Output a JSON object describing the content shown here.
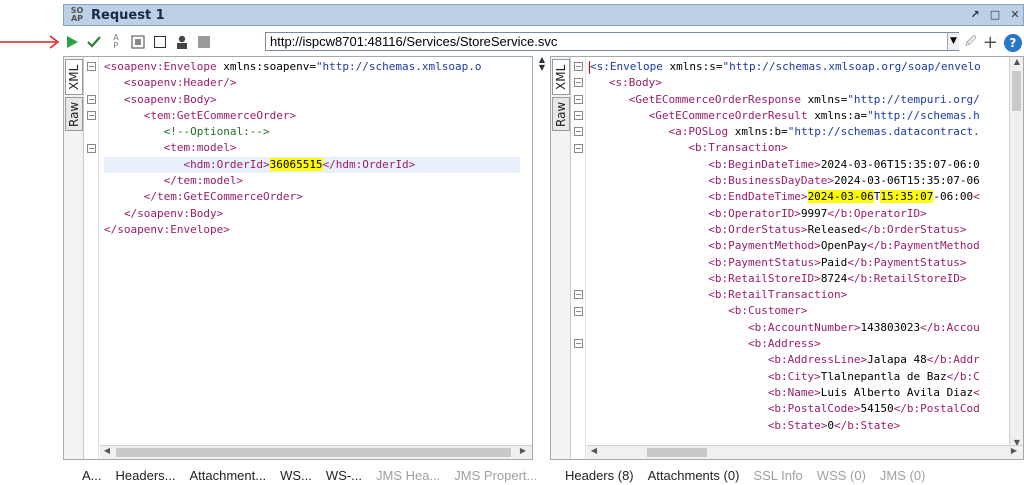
{
  "window": {
    "logo": "SO\nAP",
    "title": "Request 1",
    "buttons": [
      "restore-icon",
      "maximize-icon",
      "close-icon"
    ]
  },
  "toolbar": {
    "icons": [
      "play-icon",
      "add-wss-icon",
      "ws-a-icon",
      "format-icon",
      "checkbox-icon",
      "user-icon",
      "stop-icon"
    ],
    "url": "http://ispcw8701:48116/Services/StoreService.svc",
    "add_label": "+",
    "help_label": "?"
  },
  "request": {
    "tabs": [
      "XML",
      "Raw"
    ],
    "lines": [
      [
        {
          "c": "tag",
          "t": "<soapenv:Envelope "
        },
        {
          "c": "attr",
          "t": "xmlns:soapenv"
        },
        {
          "c": "txt",
          "t": "="
        },
        {
          "c": "str",
          "t": "\"http://schemas.xmlsoap.o"
        }
      ],
      [
        {
          "c": "txt",
          "t": "   "
        },
        {
          "c": "tag",
          "t": "<soapenv:Header/>"
        }
      ],
      [
        {
          "c": "txt",
          "t": "   "
        },
        {
          "c": "tag",
          "t": "<soapenv:Body>"
        }
      ],
      [
        {
          "c": "txt",
          "t": "      "
        },
        {
          "c": "tag",
          "t": "<tem:GetECommerceOrder>"
        }
      ],
      [
        {
          "c": "txt",
          "t": "         "
        },
        {
          "c": "cmt",
          "t": "<!--Optional:-->"
        }
      ],
      [
        {
          "c": "txt",
          "t": "         "
        },
        {
          "c": "tag",
          "t": "<tem:model>"
        }
      ],
      [
        {
          "c": "txt",
          "t": "            "
        },
        {
          "c": "tag",
          "t": "<hdm:OrderId>"
        },
        {
          "c": "hl",
          "t": "36065515"
        },
        {
          "c": "tag",
          "t": "</hdm:OrderId>"
        }
      ],
      [
        {
          "c": "txt",
          "t": "         "
        },
        {
          "c": "tag",
          "t": "</tem:model>"
        }
      ],
      [
        {
          "c": "txt",
          "t": "      "
        },
        {
          "c": "tag",
          "t": "</tem:GetECommerceOrder>"
        }
      ],
      [
        {
          "c": "txt",
          "t": "   "
        },
        {
          "c": "tag",
          "t": "</soapenv:Body>"
        }
      ],
      [
        {
          "c": "tag",
          "t": "</soapenv:Envelope>"
        }
      ]
    ],
    "bottom_tabs": [
      {
        "label": "A...",
        "enabled": true
      },
      {
        "label": "Headers...",
        "enabled": true
      },
      {
        "label": "Attachment...",
        "enabled": true
      },
      {
        "label": "WS...",
        "enabled": true
      },
      {
        "label": "WS-...",
        "enabled": true
      },
      {
        "label": "JMS Hea...",
        "enabled": false
      },
      {
        "label": "JMS Propert...",
        "enabled": false
      }
    ]
  },
  "response": {
    "tabs": [
      "XML",
      "Raw"
    ],
    "lines": [
      [
        {
          "c": "tagb",
          "t": "<s:Envelope "
        },
        {
          "c": "attr",
          "t": "xmlns:s"
        },
        {
          "c": "txt",
          "t": "="
        },
        {
          "c": "str",
          "t": "\"http://schemas.xmlsoap.org/soap/envelo"
        }
      ],
      [
        {
          "c": "txt",
          "t": "   "
        },
        {
          "c": "tag",
          "t": "<s:Body>"
        }
      ],
      [
        {
          "c": "txt",
          "t": "      "
        },
        {
          "c": "tag",
          "t": "<GetECommerceOrderResponse "
        },
        {
          "c": "attr",
          "t": "xmlns"
        },
        {
          "c": "txt",
          "t": "="
        },
        {
          "c": "str",
          "t": "\"http://tempuri.org/"
        }
      ],
      [
        {
          "c": "txt",
          "t": "         "
        },
        {
          "c": "tag",
          "t": "<GetECommerceOrderResult "
        },
        {
          "c": "attr",
          "t": "xmlns:a"
        },
        {
          "c": "txt",
          "t": "="
        },
        {
          "c": "str",
          "t": "\"http://schemas.h"
        }
      ],
      [
        {
          "c": "txt",
          "t": "            "
        },
        {
          "c": "tag",
          "t": "<a:POSLog "
        },
        {
          "c": "attr",
          "t": "xmlns:b"
        },
        {
          "c": "txt",
          "t": "="
        },
        {
          "c": "str",
          "t": "\"http://schemas.datacontract."
        }
      ],
      [
        {
          "c": "txt",
          "t": "               "
        },
        {
          "c": "tag",
          "t": "<b:Transaction>"
        }
      ],
      [
        {
          "c": "txt",
          "t": "                  "
        },
        {
          "c": "tag",
          "t": "<b:BeginDateTime>"
        },
        {
          "c": "txt",
          "t": "2024-03-06T15:35:07-06:0"
        }
      ],
      [
        {
          "c": "txt",
          "t": "                  "
        },
        {
          "c": "tag",
          "t": "<b:BusinessDayDate>"
        },
        {
          "c": "txt",
          "t": "2024-03-06T15:35:07-06"
        }
      ],
      [
        {
          "c": "txt",
          "t": "                  "
        },
        {
          "c": "tag",
          "t": "<b:EndDateTime>"
        },
        {
          "c": "hl",
          "t": "2024-03-06"
        },
        {
          "c": "txt",
          "t": "T"
        },
        {
          "c": "hl",
          "t": "15:35:07"
        },
        {
          "c": "txt",
          "t": "-06:00"
        },
        {
          "c": "tag",
          "t": "<"
        }
      ],
      [
        {
          "c": "txt",
          "t": "                  "
        },
        {
          "c": "tag",
          "t": "<b:OperatorID>"
        },
        {
          "c": "txt",
          "t": "9997"
        },
        {
          "c": "tag",
          "t": "</b:OperatorID>"
        }
      ],
      [
        {
          "c": "txt",
          "t": "                  "
        },
        {
          "c": "tag",
          "t": "<b:OrderStatus>"
        },
        {
          "c": "txt",
          "t": "Released"
        },
        {
          "c": "tag",
          "t": "</b:OrderStatus>"
        }
      ],
      [
        {
          "c": "txt",
          "t": "                  "
        },
        {
          "c": "tag",
          "t": "<b:PaymentMethod>"
        },
        {
          "c": "txt",
          "t": "OpenPay"
        },
        {
          "c": "tag",
          "t": "</b:PaymentMethod"
        }
      ],
      [
        {
          "c": "txt",
          "t": "                  "
        },
        {
          "c": "tag",
          "t": "<b:PaymentStatus>"
        },
        {
          "c": "txt",
          "t": "Paid"
        },
        {
          "c": "tag",
          "t": "</b:PaymentStatus>"
        }
      ],
      [
        {
          "c": "txt",
          "t": "                  "
        },
        {
          "c": "tag",
          "t": "<b:RetailStoreID>"
        },
        {
          "c": "txt",
          "t": "8724"
        },
        {
          "c": "tag",
          "t": "</b:RetailStoreID>"
        }
      ],
      [
        {
          "c": "txt",
          "t": "                  "
        },
        {
          "c": "tag",
          "t": "<b:RetailTransaction>"
        }
      ],
      [
        {
          "c": "txt",
          "t": "                     "
        },
        {
          "c": "tag",
          "t": "<b:Customer>"
        }
      ],
      [
        {
          "c": "txt",
          "t": "                        "
        },
        {
          "c": "tag",
          "t": "<b:AccountNumber>"
        },
        {
          "c": "txt",
          "t": "143803023"
        },
        {
          "c": "tag",
          "t": "</b:Accou"
        }
      ],
      [
        {
          "c": "txt",
          "t": "                        "
        },
        {
          "c": "tag",
          "t": "<b:Address>"
        }
      ],
      [
        {
          "c": "txt",
          "t": "                           "
        },
        {
          "c": "tag",
          "t": "<b:AddressLine>"
        },
        {
          "c": "txt",
          "t": "Jalapa 48"
        },
        {
          "c": "tag",
          "t": "</b:Addr"
        }
      ],
      [
        {
          "c": "txt",
          "t": "                           "
        },
        {
          "c": "tag",
          "t": "<b:City>"
        },
        {
          "c": "txt",
          "t": "Tlalnepantla de Baz"
        },
        {
          "c": "tag",
          "t": "</b:C"
        }
      ],
      [
        {
          "c": "txt",
          "t": "                           "
        },
        {
          "c": "tag",
          "t": "<b:Name>"
        },
        {
          "c": "txt",
          "t": "Luis Alberto Avila Diaz"
        },
        {
          "c": "tag",
          "t": "<"
        }
      ],
      [
        {
          "c": "txt",
          "t": "                           "
        },
        {
          "c": "tag",
          "t": "<b:PostalCode>"
        },
        {
          "c": "txt",
          "t": "54150"
        },
        {
          "c": "tag",
          "t": "</b:PostalCod"
        }
      ],
      [
        {
          "c": "txt",
          "t": "                           "
        },
        {
          "c": "tag",
          "t": "<b:State>"
        },
        {
          "c": "txt",
          "t": "0"
        },
        {
          "c": "tag",
          "t": "</b:State>"
        }
      ]
    ],
    "bottom_tabs": [
      {
        "label": "Headers (8)",
        "enabled": true
      },
      {
        "label": "Attachments (0)",
        "enabled": true
      },
      {
        "label": "SSL Info",
        "enabled": false
      },
      {
        "label": "WSS (0)",
        "enabled": false
      },
      {
        "label": "JMS (0)",
        "enabled": false
      }
    ]
  },
  "colors": {
    "tag": "#9b1c6b",
    "response_root_tag": "#1c3aa8",
    "attribute": "#000000",
    "string": "#1c3aa8",
    "comment": "#236e25",
    "highlight": "#ffff00",
    "titlebar": "#b9cde5",
    "annotation_arrow": "#e02020"
  }
}
